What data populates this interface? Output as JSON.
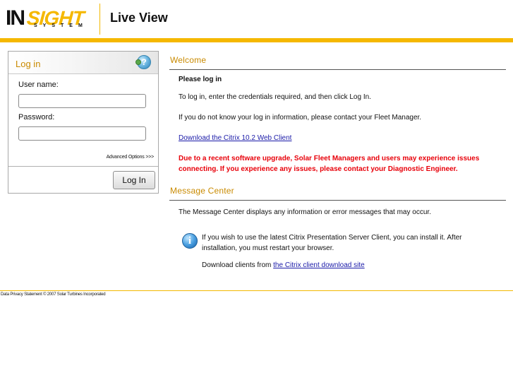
{
  "header": {
    "logo_main_i": "IN",
    "logo_main_sight": "SIGHT",
    "logo_sub": "SYSTEM",
    "app_title": "Live View"
  },
  "login": {
    "title": "Log in",
    "username_label": "User name:",
    "username_value": "",
    "password_label": "Password:",
    "password_value": "",
    "advanced_options": "Advanced Options >>>",
    "login_button": "Log In"
  },
  "welcome": {
    "title": "Welcome",
    "please_log_in": "Please log in",
    "instructions": "To log in, enter the credentials required, and then click Log In.",
    "contact": "If you do not know your log in information, please contact your Fleet Manager.",
    "download_link": "Download the Citrix 10.2 Web Client",
    "warning_line1": "Due to a recent software upgrade, Solar Fleet Managers and users may experience issues",
    "warning_line2": "connecting. If you experience any issues, please contact your Diagnostic Engineer."
  },
  "message_center": {
    "title": "Message Center",
    "description": "The Message Center displays any information or error messages that may occur.",
    "info_line1": "If you wish to use the latest Citrix Presentation Server Client, you can install it. After",
    "info_line2": "installation, you must restart your browser.",
    "download_prefix": "Download clients from ",
    "download_link": "the Citrix client download site"
  },
  "footer": {
    "text": "Data Privacy Statement © 2007 Solar Turbines Incorporated"
  },
  "icons": {
    "help": "help-icon",
    "info": "info-icon"
  },
  "colors": {
    "brand_yellow": "#f5b800",
    "section_title": "#c98a00",
    "warning": "#e8000a",
    "link": "#1a1aa8"
  }
}
